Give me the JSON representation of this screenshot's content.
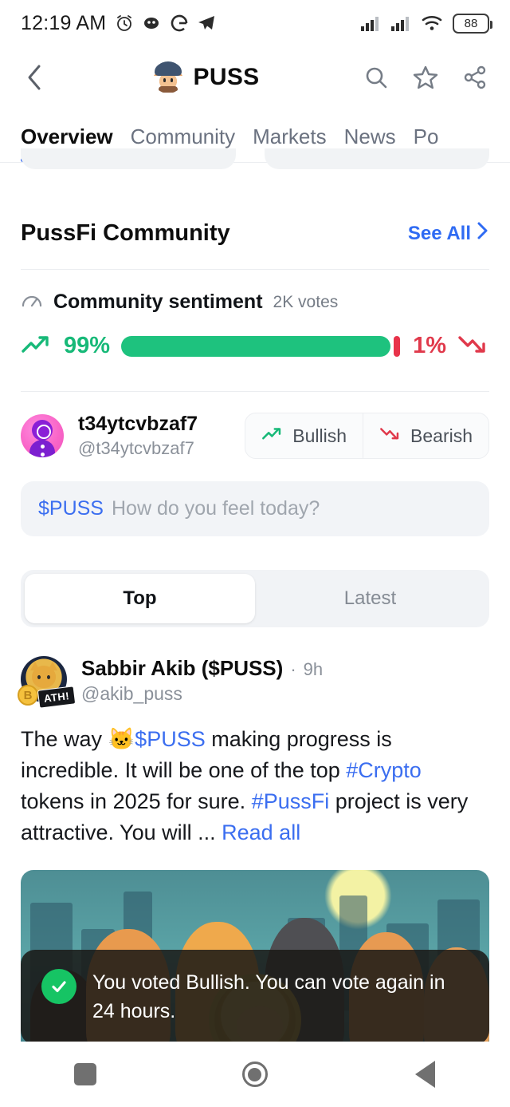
{
  "status_bar": {
    "time": "12:19 AM",
    "icons_left": [
      "alarm-icon",
      "discord-icon",
      "google-icon",
      "telegram-icon"
    ],
    "icons_right": [
      "signal-bars-1",
      "signal-bars-2",
      "wifi-icon"
    ],
    "battery_level": "88"
  },
  "header": {
    "back_icon": "chevron-left-icon",
    "title": "PUSS",
    "logo": "puss-cat-logo",
    "actions": [
      "search-icon",
      "star-icon",
      "share-icon"
    ]
  },
  "tabs": [
    {
      "label": "Overview",
      "active": true
    },
    {
      "label": "Community",
      "active": false
    },
    {
      "label": "Markets",
      "active": false
    },
    {
      "label": "News",
      "active": false
    },
    {
      "label": "Po",
      "active": false
    }
  ],
  "community": {
    "section_title": "PussFi Community",
    "see_all_label": "See All",
    "see_all_chevron": "chevron-right-icon"
  },
  "sentiment": {
    "icon": "gauge-icon",
    "title": "Community sentiment",
    "votes": "2K votes",
    "bullish_pct": "99%",
    "bearish_pct": "1%",
    "bullish_value": 99,
    "bearish_value": 1,
    "bullish_color": "#1ec27e",
    "bearish_color": "#e8334a"
  },
  "vote_row": {
    "avatar": "user-avatar",
    "name": "t34ytcvbzaf7",
    "handle": "@t34ytcvbzaf7",
    "bullish_label": "Bullish",
    "bearish_label": "Bearish"
  },
  "composer": {
    "tag": "$PUSS",
    "placeholder": "How do you feel today?"
  },
  "segmented": {
    "top_label": "Top",
    "latest_label": "Latest",
    "active": "Top"
  },
  "post": {
    "author_name": "Sabbir Akib ($PUSS)",
    "separator": "·",
    "time": "9h",
    "handle": "@akib_puss",
    "badge": "ATH!",
    "body": {
      "part1": "The way ",
      "emoji": "🐱",
      "token": "$PUSS",
      "part2": " making progress is incredible. It will be one of the top ",
      "hashtag1": "#Crypto",
      "part3": " tokens in 2025 for sure. ",
      "hashtag2": "#PussFi",
      "part4": " project is very attractive. You will ... ",
      "read_all": "Read all"
    },
    "image_alt": "cheering-cats-illustration"
  },
  "toast": {
    "icon": "check-circle-icon",
    "message": "You voted Bullish. You can vote again in 24 hours.",
    "accent_color": "#16c464"
  },
  "nav_bar": {
    "recents": "recents-square-icon",
    "home": "home-circle-icon",
    "back": "back-triangle-icon"
  }
}
